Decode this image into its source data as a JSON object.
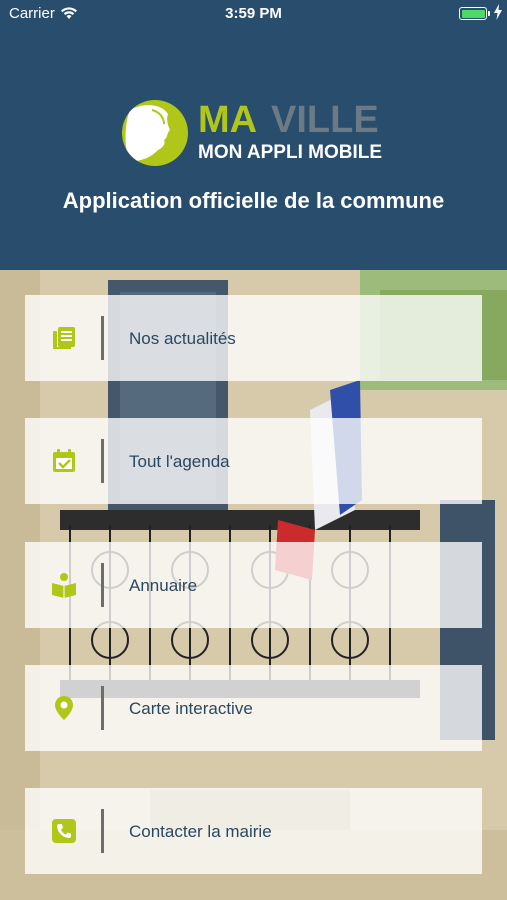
{
  "status_bar": {
    "carrier": "Carrier",
    "time": "3:59 PM"
  },
  "brand": {
    "ma": "MA",
    "ville": "VILLE",
    "subtitle": "MON APPLI MOBILE"
  },
  "tagline": "Application officielle de la commune",
  "colors": {
    "header_bg": "#294d6c",
    "accent": "#b0c71a",
    "label": "#2b4760"
  },
  "menu": [
    {
      "label": "Nos actualités",
      "icon": "news-icon"
    },
    {
      "label": "Tout l'agenda",
      "icon": "calendar-icon"
    },
    {
      "label": "Annuaire",
      "icon": "directory-book-icon"
    },
    {
      "label": "Carte interactive",
      "icon": "map-pin-icon"
    },
    {
      "label": "Contacter la mairie",
      "icon": "phone-icon"
    }
  ]
}
